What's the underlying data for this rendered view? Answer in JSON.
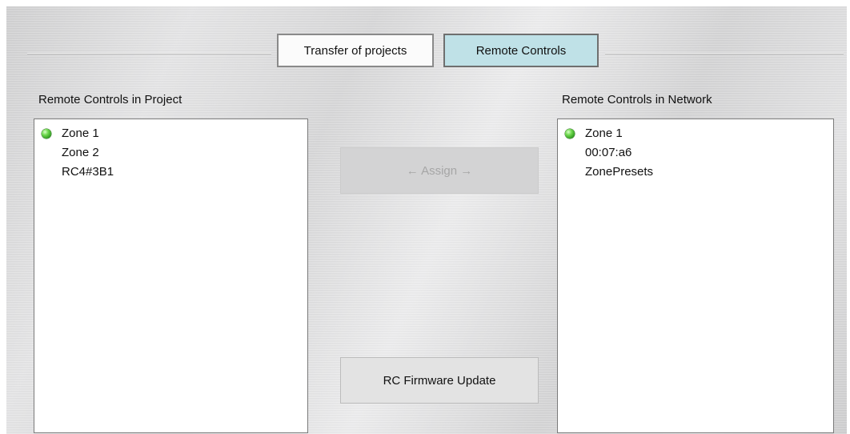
{
  "tabs": {
    "transfer_label": "Transfer of projects",
    "remote_label": "Remote Controls"
  },
  "project_list": {
    "caption": "Remote Controls in Project",
    "items": [
      {
        "label": "Zone 1",
        "status": "online",
        "status_color": "#3fbf2a"
      },
      {
        "label": "Zone 2"
      },
      {
        "label": "RC4#3B1"
      }
    ]
  },
  "network_list": {
    "caption": "Remote Controls in Network",
    "items": [
      {
        "label": "Zone 1",
        "status": "online",
        "status_color": "#3fbf2a"
      },
      {
        "label": "00:07:a6"
      },
      {
        "label": "ZonePresets"
      }
    ]
  },
  "buttons": {
    "assign_label": "← Assign →",
    "assign_enabled": false,
    "firmware_label": "RC Firmware Update"
  },
  "colors": {
    "active_tab": "#bfe1e7",
    "status_led": "#3fbf2a"
  }
}
